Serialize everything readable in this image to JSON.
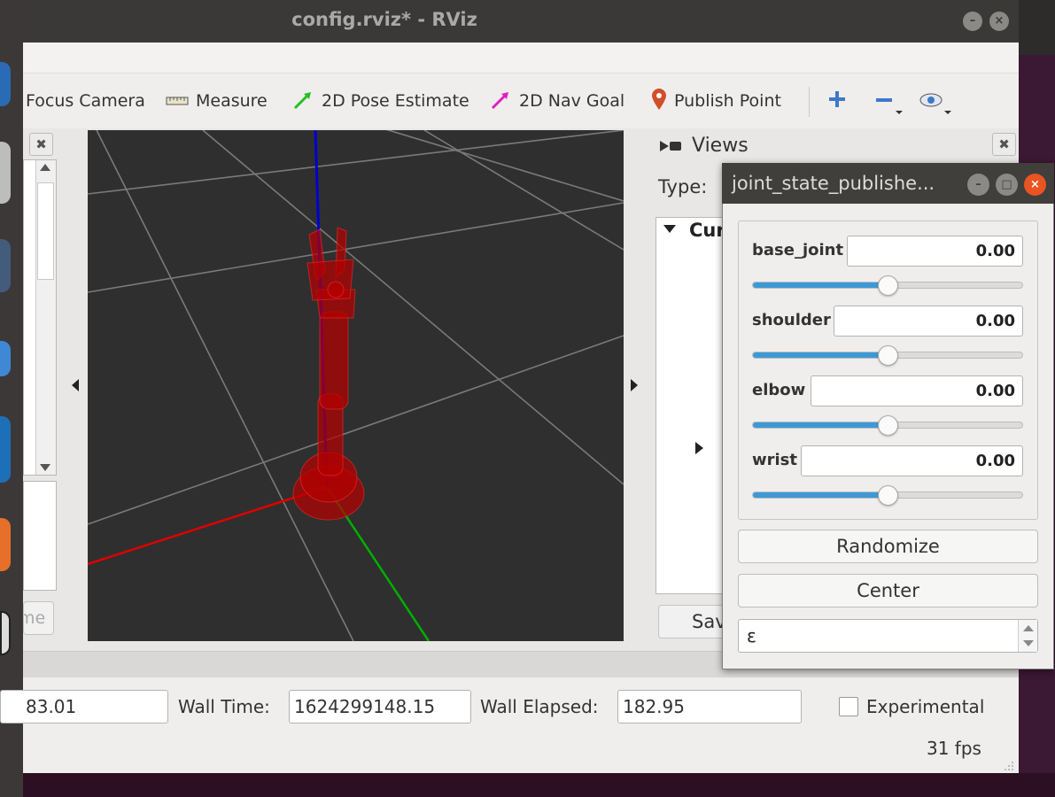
{
  "window": {
    "title": "config.rviz* - RViz"
  },
  "toolbar": {
    "focus_camera": "Focus Camera",
    "measure": "Measure",
    "pose_estimate": "2D Pose Estimate",
    "nav_goal": "2D Nav Goal",
    "publish_point": "Publish Point"
  },
  "left_panel": {
    "button_label": "me"
  },
  "views_panel": {
    "title": "Views",
    "type_label": "Type:",
    "current_label": "Cur",
    "save_label": "Sav"
  },
  "time_panel": {
    "ros_elapsed_value": "83.01",
    "wall_time_label": "Wall Time:",
    "wall_time_value": "1624299148.15",
    "wall_elapsed_label": "Wall Elapsed:",
    "wall_elapsed_value": "182.95",
    "experimental_label": "Experimental",
    "fps": "31 fps"
  },
  "joint_state_publisher": {
    "title": "joint_state_publishe...",
    "joints": [
      {
        "name": "base_joint",
        "value": "0.00",
        "slider_fraction": 0.5
      },
      {
        "name": "shoulder",
        "value": "0.00",
        "slider_fraction": 0.5
      },
      {
        "name": "elbow",
        "value": "0.00",
        "slider_fraction": 0.5
      },
      {
        "name": "wrist",
        "value": "0.00",
        "slider_fraction": 0.5
      }
    ],
    "randomize_label": "Randomize",
    "center_label": "Center",
    "spinbox_value": "ε"
  },
  "colors": {
    "x_axis": "#e00000",
    "y_axis": "#00b000",
    "z_axis": "#0000d0",
    "robot": "#c00000",
    "slider_fill": "#3d99d6",
    "close_button": "#e95420"
  }
}
